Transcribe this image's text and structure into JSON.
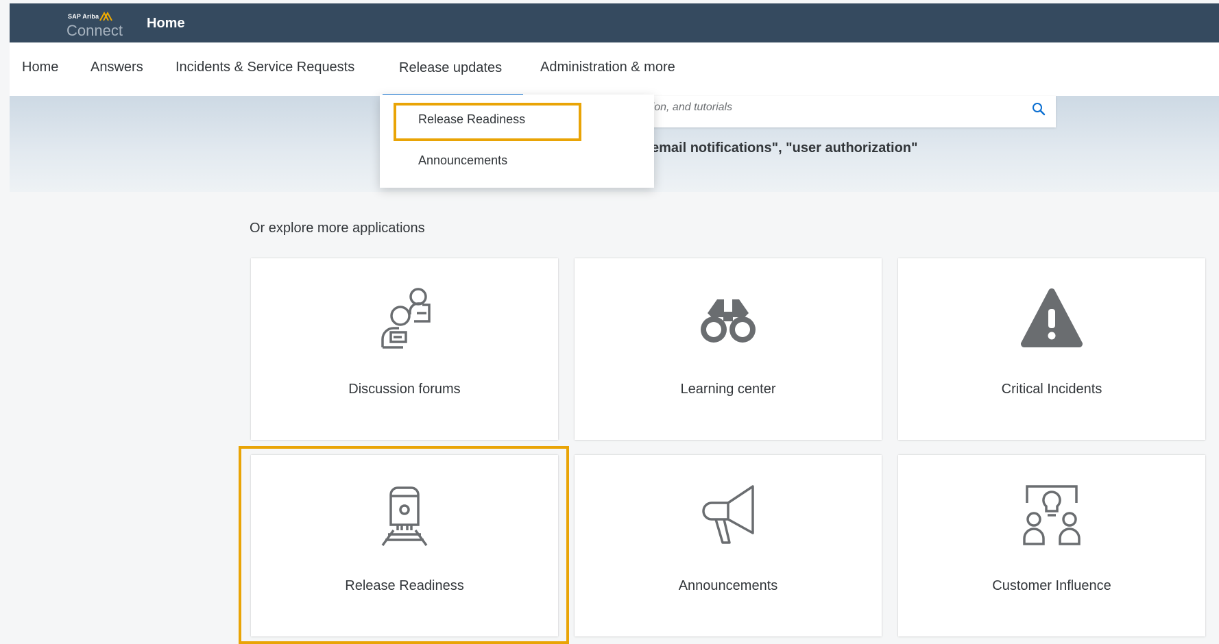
{
  "header": {
    "brand_top": "SAP Ariba",
    "brand_name": "Connect",
    "title": "Home"
  },
  "nav": {
    "items": [
      {
        "label": "Home"
      },
      {
        "label": "Answers"
      },
      {
        "label": "Incidents & Service Requests"
      },
      {
        "label": "Release updates",
        "active": true
      },
      {
        "label": "Administration & more"
      }
    ]
  },
  "dropdown": {
    "items": [
      {
        "label": "Release Readiness",
        "highlighted": true
      },
      {
        "label": "Announcements"
      }
    ]
  },
  "search": {
    "placeholder_visible": "ntation, and tutorials",
    "hint": "email notifications\", \"user authorization\""
  },
  "explore": {
    "title": "Or explore more applications",
    "tiles": [
      {
        "label": "Discussion forums",
        "icon": "discussion-forum-icon"
      },
      {
        "label": "Learning center",
        "icon": "binoculars-icon"
      },
      {
        "label": "Critical Incidents",
        "icon": "warning-icon"
      },
      {
        "label": "Release Readiness",
        "icon": "train-icon",
        "highlighted": true
      },
      {
        "label": "Announcements",
        "icon": "megaphone-icon"
      },
      {
        "label": "Customer Influence",
        "icon": "idea-group-icon"
      }
    ]
  },
  "colors": {
    "shell_bar": "#354a5f",
    "accent": "#0a6ed1",
    "highlight": "#e9a406",
    "icon": "#6a6d70"
  }
}
